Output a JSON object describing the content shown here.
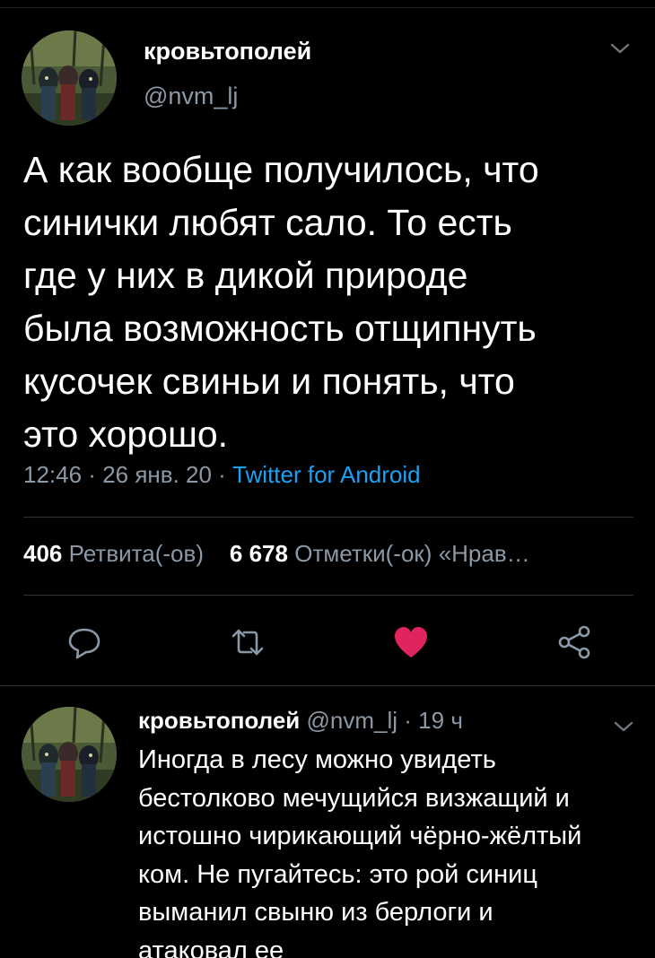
{
  "tweet": {
    "author": {
      "display_name": "кровьтополей",
      "handle": "@nvm_lj",
      "avatar": "painting-avatar"
    },
    "text": "А как вообще получилось, что\nсинички любят сало. То есть\nгде у них в дикой природе\nбыла возможность отщипнуть\nкусочек свиньи и понять, что\nэто хорошо.",
    "time": "12:46",
    "date": "26 янв. 20",
    "separator": " · ",
    "source": "Twitter for Android",
    "stats": {
      "retweets_count": "406",
      "retweets_label": "Ретвита(-ов)",
      "likes_count": "6 678",
      "likes_label": "Отметки(-ок)",
      "liked_by_label": "«Нрав…"
    },
    "actions": {
      "reply_icon": "speech-bubble-icon",
      "retweet_icon": "retweet-icon",
      "like_icon": "heart-icon",
      "share_icon": "share-icon"
    }
  },
  "reply": {
    "author": {
      "display_name": "кровьтополей",
      "handle": "@nvm_lj",
      "time_ago": "19 ч"
    },
    "text": "Иногда в лесу можно увидеть\nбестолково мечущийся визжащий и\nистошно чирикающий чёрно-жёлтый\nком. Не пугайтесь: это рой синиц\nвыманил свыню из берлоги и\nатаковал ее"
  },
  "colors": {
    "background": "#000000",
    "text_primary": "#ffffff",
    "text_secondary": "#8b98a5",
    "link": "#1da1f2",
    "like_active": "#e0245e",
    "divider": "#2f3336"
  }
}
